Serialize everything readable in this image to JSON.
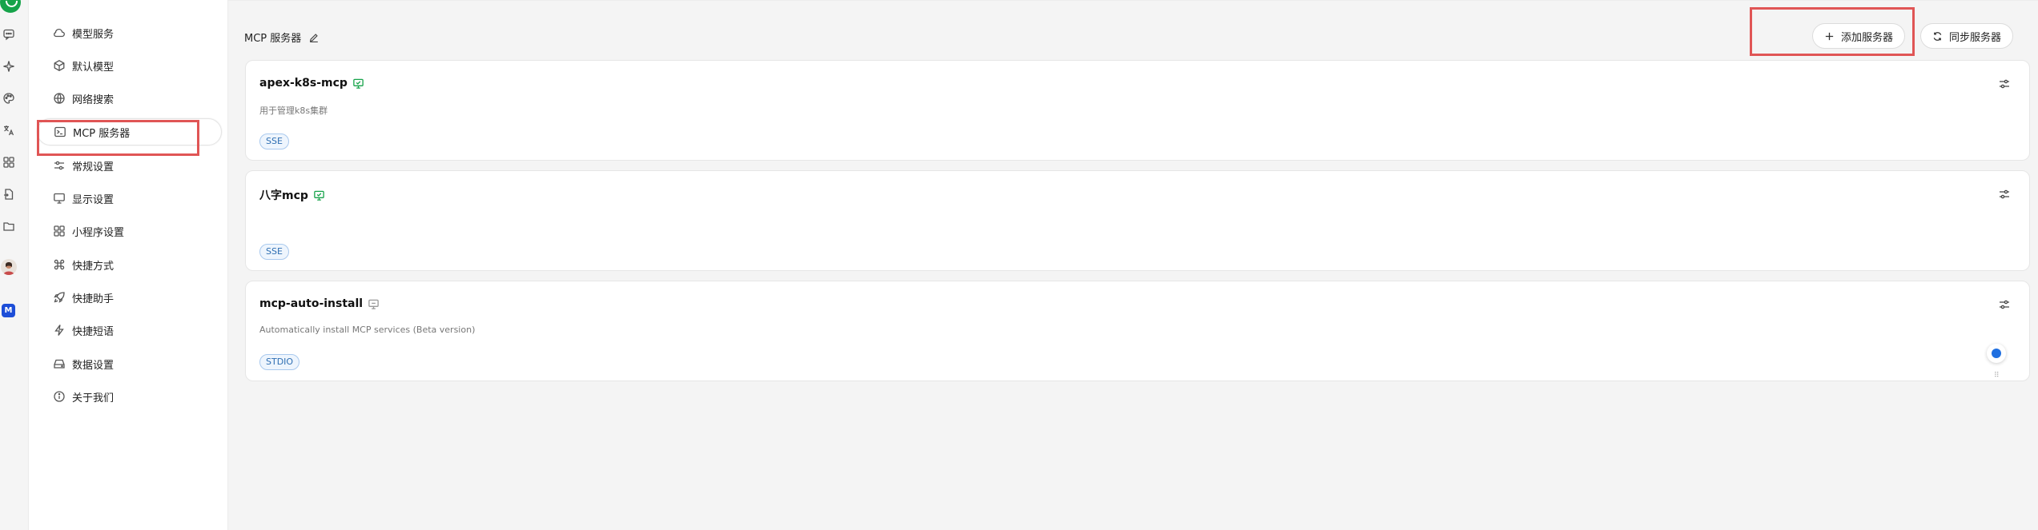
{
  "rail": {
    "icons": [
      "chat-icon",
      "sparkle-icon",
      "palette-icon",
      "translate-icon",
      "grid-icon",
      "file-transfer-icon",
      "folder-icon"
    ]
  },
  "sidebar": {
    "items": [
      {
        "label": "模型服务",
        "icon": "cloud-icon"
      },
      {
        "label": "默认模型",
        "icon": "cube-icon"
      },
      {
        "label": "网络搜索",
        "icon": "globe-icon"
      },
      {
        "label": "MCP 服务器",
        "icon": "terminal-icon",
        "active": true
      },
      {
        "label": "常规设置",
        "icon": "sliders-icon"
      },
      {
        "label": "显示设置",
        "icon": "monitor-icon"
      },
      {
        "label": "小程序设置",
        "icon": "grid-icon"
      },
      {
        "label": "快捷方式",
        "icon": "command-icon"
      },
      {
        "label": "快捷助手",
        "icon": "rocket-icon"
      },
      {
        "label": "快捷短语",
        "icon": "lightning-icon"
      },
      {
        "label": "数据设置",
        "icon": "hard-drive-icon"
      },
      {
        "label": "关于我们",
        "icon": "info-icon"
      }
    ]
  },
  "header": {
    "title": "MCP 服务器",
    "add_label": "添加服务器",
    "sync_label": "同步服务器"
  },
  "servers": [
    {
      "name": "apex-k8s-mcp",
      "description": "用于管理k8s集群",
      "type": "SSE",
      "enabled": true
    },
    {
      "name": "八字mcp",
      "description": "",
      "type": "SSE",
      "enabled": true
    },
    {
      "name": "mcp-auto-install",
      "description": "Automatically install MCP services (Beta version)",
      "type": "STDIO",
      "enabled": false
    }
  ],
  "colors": {
    "accent_green": "#16a34a",
    "highlight_red": "#e05555",
    "tag_blue": "#2f6fb3",
    "disabled_gray": "#999999"
  }
}
